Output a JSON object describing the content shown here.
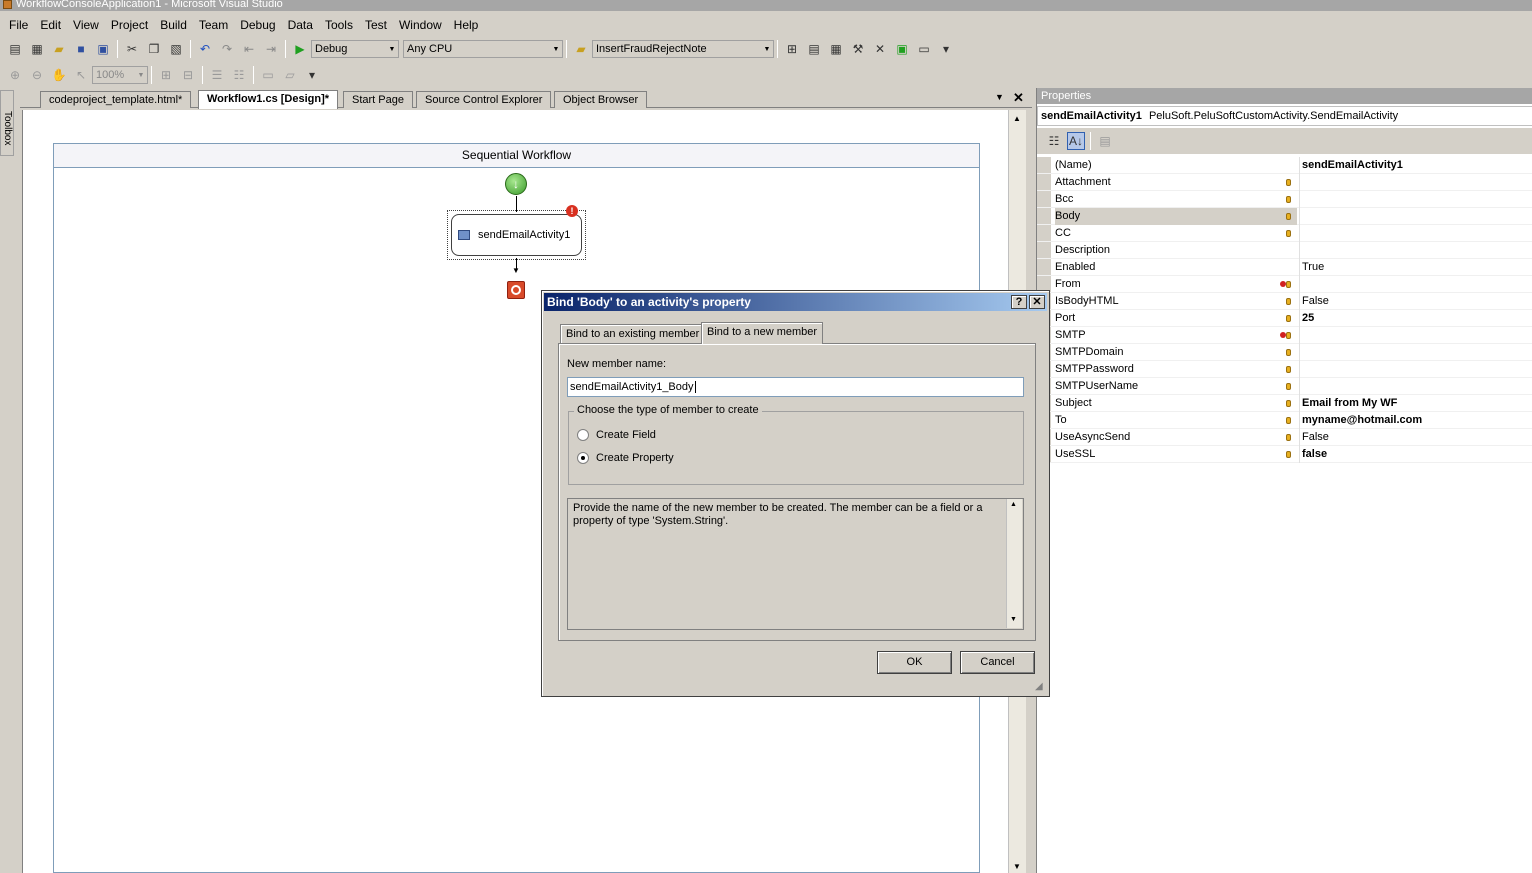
{
  "window": {
    "title": "WorkflowConsoleApplication1 - Microsoft Visual Studio"
  },
  "menu": {
    "items": [
      {
        "label": "File"
      },
      {
        "label": "Edit"
      },
      {
        "label": "View"
      },
      {
        "label": "Project"
      },
      {
        "label": "Build"
      },
      {
        "label": "Team"
      },
      {
        "label": "Debug"
      },
      {
        "label": "Data"
      },
      {
        "label": "Tools"
      },
      {
        "label": "Test"
      },
      {
        "label": "Window"
      },
      {
        "label": "Help"
      }
    ]
  },
  "toolbar": {
    "configuration": "Debug",
    "platform": "Any CPU",
    "find_target": "InsertFraudRejectNote",
    "zoom": "100%"
  },
  "tabs": [
    {
      "label": "codeproject_template.html*"
    },
    {
      "label": "Workflow1.cs [Design]*",
      "active": true
    },
    {
      "label": "Start Page"
    },
    {
      "label": "Source Control Explorer"
    },
    {
      "label": "Object Browser"
    }
  ],
  "toolbox": {
    "label": "Toolbox"
  },
  "designer": {
    "header": "Sequential Workflow",
    "activity_label": "sendEmailActivity1"
  },
  "properties": {
    "title": "Properties",
    "object_name": "sendEmailActivity1",
    "object_type": "PeluSoft.PeluSoftCustomActivity.SendEmailActivity",
    "rows": [
      {
        "name": "(Name)",
        "value": "sendEmailActivity1",
        "bold": true,
        "bind": false,
        "error": false
      },
      {
        "name": "Attachment",
        "value": "",
        "bind": true,
        "error": false
      },
      {
        "name": "Bcc",
        "value": "",
        "bind": true,
        "error": false
      },
      {
        "name": "Body",
        "value": "",
        "bind": true,
        "error": false,
        "selected": true
      },
      {
        "name": "CC",
        "value": "",
        "bind": true,
        "error": false
      },
      {
        "name": "Description",
        "value": "",
        "bind": false,
        "error": false
      },
      {
        "name": "Enabled",
        "value": "True",
        "bind": false,
        "error": false
      },
      {
        "name": "From",
        "value": "",
        "bind": true,
        "error": true
      },
      {
        "name": "IsBodyHTML",
        "value": "False",
        "bind": true,
        "error": false
      },
      {
        "name": "Port",
        "value": "25",
        "bold": true,
        "bind": true,
        "error": false
      },
      {
        "name": "SMTP",
        "value": "",
        "bind": true,
        "error": true
      },
      {
        "name": "SMTPDomain",
        "value": "",
        "bind": true,
        "error": false
      },
      {
        "name": "SMTPPassword",
        "value": "",
        "bind": true,
        "error": false
      },
      {
        "name": "SMTPUserName",
        "value": "",
        "bind": true,
        "error": false
      },
      {
        "name": "Subject",
        "value": "Email from My WF",
        "bold": true,
        "bind": true,
        "error": false
      },
      {
        "name": "To",
        "value": "myname@hotmail.com",
        "bold": true,
        "bind": true,
        "error": false
      },
      {
        "name": "UseAsyncSend",
        "value": "False",
        "bind": true,
        "error": false
      },
      {
        "name": "UseSSL",
        "value": "false",
        "bold": true,
        "bind": true,
        "error": false
      }
    ]
  },
  "dialog": {
    "title": "Bind 'Body' to an activity's property",
    "help_label": "?",
    "close_label": "✕",
    "tab_existing": "Bind to an existing member",
    "tab_new": "Bind to a new member",
    "member_label": "New member name:",
    "member_value": "sendEmailActivity1_Body",
    "group_label": "Choose the type of member to create",
    "option_field": "Create Field",
    "option_property": "Create Property",
    "selected_option": "property",
    "description": "Provide the name of the new member to be created. The member can be a field or a property of type 'System.String'.",
    "ok_label": "OK",
    "cancel_label": "Cancel"
  }
}
